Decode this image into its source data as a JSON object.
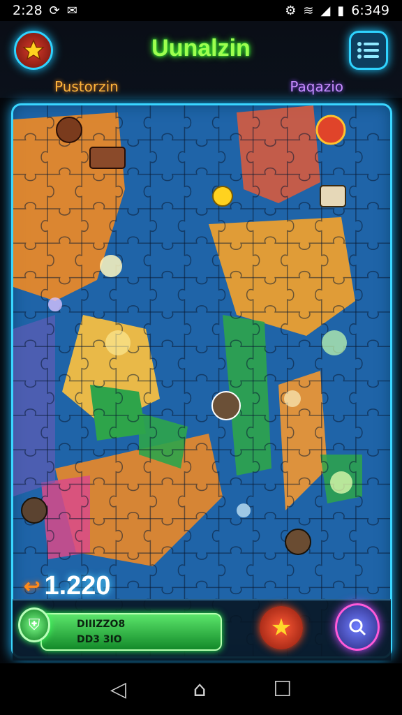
{
  "status_bar": {
    "time_left": "2:28",
    "time_right": "6:349",
    "icons": [
      "sync-icon",
      "notification-icon",
      "settings-icon",
      "wifi-icon",
      "signal-icon",
      "battery-icon"
    ]
  },
  "header": {
    "title": "Uunalzin",
    "left_label": "Pustorzin",
    "right_label": "Paqazio"
  },
  "board": {
    "rows": 16,
    "cols": 11,
    "colors": {
      "ocean": "#1f64a8",
      "orange": "#f08a24",
      "yellow": "#ffc23d",
      "green": "#2ea44a",
      "pink": "#d94a8a",
      "teal": "#2a8fb5",
      "purple": "#6a5ab8"
    }
  },
  "footer": {
    "score": "1.220",
    "progress_line1": "DIIIZZO8",
    "progress_line2": "DD3 3IO"
  },
  "nav": {
    "back": "◁",
    "home": "⌂",
    "recents": "☐"
  }
}
